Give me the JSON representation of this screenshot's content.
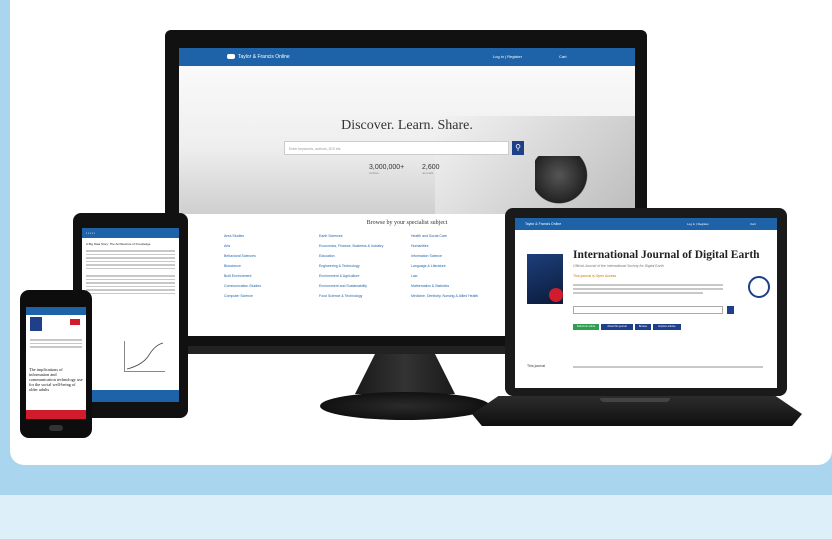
{
  "monitor": {
    "brand": "Taylor & Francis Online",
    "nav": [
      "Log in | Register",
      "Cart"
    ],
    "hero_title": "Discover. Learn. Share.",
    "search_placeholder": "Enter keywords, authors, DOI etc",
    "stats": [
      {
        "value": "3,000,000+",
        "label": "Articles"
      },
      {
        "value": "2,600",
        "label": "Journals"
      }
    ],
    "browse_title": "Browse by your specialist subject",
    "subjects_col1": [
      "Area Studies",
      "Arts",
      "Behavioral Sciences",
      "Bioscience",
      "Built Environment",
      "Communication Studies",
      "Computer Science"
    ],
    "subjects_col2": [
      "Earth Sciences",
      "Economics, Finance, Business & Industry",
      "Education",
      "Engineering & Technology",
      "Environment & Agriculture",
      "Environment and Sustainability",
      "Food Science & Technology"
    ],
    "subjects_col3": [
      "Health and Social Care",
      "Humanities",
      "Information Science",
      "Language & Literature",
      "Law",
      "Mathematics & Statistics",
      "Medicine, Dentistry, Nursing & Allied Health"
    ]
  },
  "tablet": {
    "title": "A Big Data Story: The Architecture of Knowledge"
  },
  "phone": {
    "heading": "The implications of information and communication technology use for the social well-being of older adults"
  },
  "laptop": {
    "brand": "Taylor & Francis Online",
    "nav": [
      "Log in | Register",
      "Cart"
    ],
    "journal_title": "International Journal of Digital Earth",
    "journal_subtitle": "Official Journal of the International Society for Digital Earth",
    "open_access_note": "This journal is Open Access",
    "buttons": [
      "Submit an article",
      "About this journal",
      "Browse",
      "Explore articles"
    ],
    "section_label": "This journal"
  },
  "colors": {
    "brand_blue": "#1e62a8",
    "accent_red": "#d01c2c",
    "page_bg": "#a9d6ee"
  }
}
